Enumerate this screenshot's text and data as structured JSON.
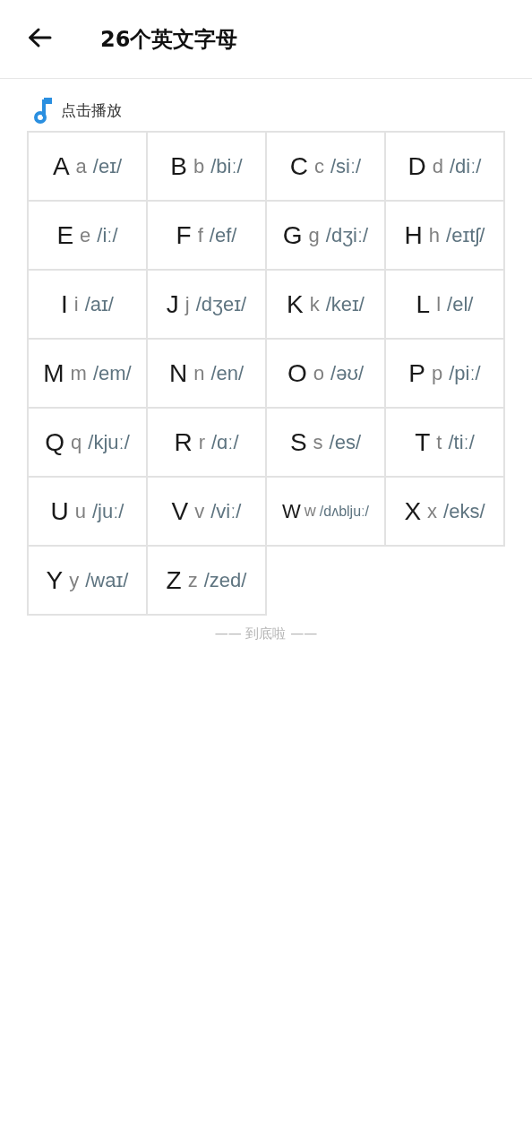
{
  "header": {
    "title": "26个英文字母"
  },
  "play": {
    "label": "点击播放"
  },
  "letters": [
    {
      "upper": "A",
      "lower": "a",
      "phonetic": "/eɪ/"
    },
    {
      "upper": "B",
      "lower": "b",
      "phonetic": "/biː/"
    },
    {
      "upper": "C",
      "lower": "c",
      "phonetic": "/siː/"
    },
    {
      "upper": "D",
      "lower": "d",
      "phonetic": "/diː/"
    },
    {
      "upper": "E",
      "lower": "e",
      "phonetic": "/iː/"
    },
    {
      "upper": "F",
      "lower": "f",
      "phonetic": "/ef/"
    },
    {
      "upper": "G",
      "lower": "g",
      "phonetic": "/dʒiː/"
    },
    {
      "upper": "H",
      "lower": "h",
      "phonetic": "/eɪtʃ/"
    },
    {
      "upper": "I",
      "lower": "i",
      "phonetic": "/aɪ/"
    },
    {
      "upper": "J",
      "lower": "j",
      "phonetic": "/dʒeɪ/"
    },
    {
      "upper": "K",
      "lower": "k",
      "phonetic": "/keɪ/"
    },
    {
      "upper": "L",
      "lower": "l",
      "phonetic": "/el/"
    },
    {
      "upper": "M",
      "lower": "m",
      "phonetic": "/em/"
    },
    {
      "upper": "N",
      "lower": "n",
      "phonetic": "/en/"
    },
    {
      "upper": "O",
      "lower": "o",
      "phonetic": "/əʊ/"
    },
    {
      "upper": "P",
      "lower": "p",
      "phonetic": "/piː/"
    },
    {
      "upper": "Q",
      "lower": "q",
      "phonetic": "/kjuː/"
    },
    {
      "upper": "R",
      "lower": "r",
      "phonetic": "/ɑː/"
    },
    {
      "upper": "S",
      "lower": "s",
      "phonetic": "/es/"
    },
    {
      "upper": "T",
      "lower": "t",
      "phonetic": "/tiː/"
    },
    {
      "upper": "U",
      "lower": "u",
      "phonetic": "/juː/"
    },
    {
      "upper": "V",
      "lower": "v",
      "phonetic": "/viː/"
    },
    {
      "upper": "W",
      "lower": "w",
      "phonetic": "/dʌbljuː/"
    },
    {
      "upper": "X",
      "lower": "x",
      "phonetic": "/eks/"
    },
    {
      "upper": "Y",
      "lower": "y",
      "phonetic": "/waɪ/"
    },
    {
      "upper": "Z",
      "lower": "z",
      "phonetic": "/zed/"
    }
  ],
  "footer": {
    "text": "—— 到底啦 ——"
  }
}
